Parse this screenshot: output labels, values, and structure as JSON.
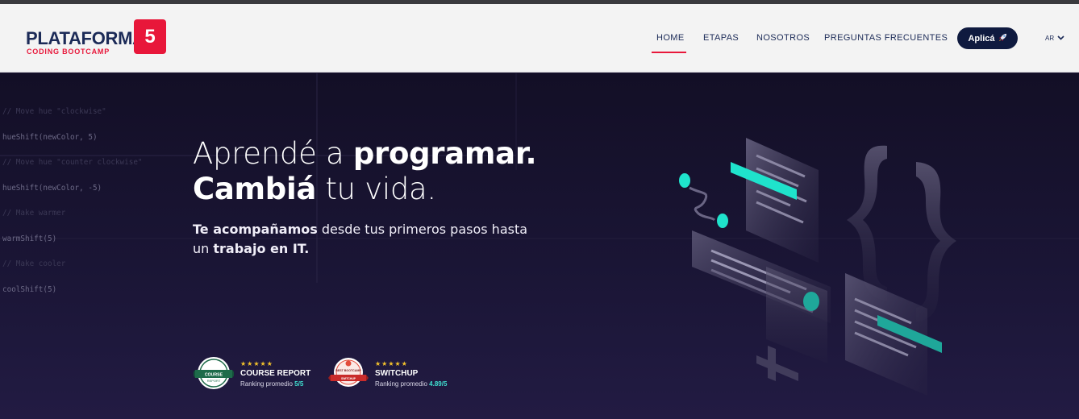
{
  "brand": {
    "name": "PLATAFORMA",
    "number": "5",
    "tagline": "CODING BOOTCAMP"
  },
  "nav": {
    "items": [
      "HOME",
      "ETAPAS",
      "NOSOTROS",
      "PREGUNTAS FRECUENTES"
    ],
    "active": "HOME",
    "apply_label": "Aplicá",
    "apply_icon": "rocket-icon",
    "lang": "AR"
  },
  "code_bg": [
    "// Move hue \"clockwise\"",
    "hueShift(newColor, 5)",
    "// Move hue \"counter clockwise\"",
    "hueShift(newColor, -5)",
    "// Make warmer",
    "warmShift(5)",
    "// Make cooler",
    "coolShift(5)"
  ],
  "hero": {
    "line1_light": "Aprendé a ",
    "line1_bold": "programar.",
    "line2_bold": "Cambiá",
    "line2_light": " tu vida.",
    "sub1_bold": "Te acompañamos",
    "sub1_rest": " desde tus primeros pasos hasta",
    "sub2_start": "un ",
    "sub2_bold": "trabajo en IT."
  },
  "badges": [
    {
      "stars": "★★★★★",
      "name": "COURSE REPORT",
      "rank_label": "Ranking promedio ",
      "rank_value": "5/5",
      "seal_text": "COURSE REPORT"
    },
    {
      "stars": "★★★★★",
      "name": "SWITCHUP",
      "rank_label": "Ranking promedio ",
      "rank_value": "4.89/5",
      "seal_text": "BEST BOOTCAMP AWARD"
    }
  ],
  "colors": {
    "brand_navy": "#1b2a57",
    "brand_red": "#e8173a",
    "accent_teal": "#1fe3cc",
    "hero_bg": "#1a1433"
  }
}
